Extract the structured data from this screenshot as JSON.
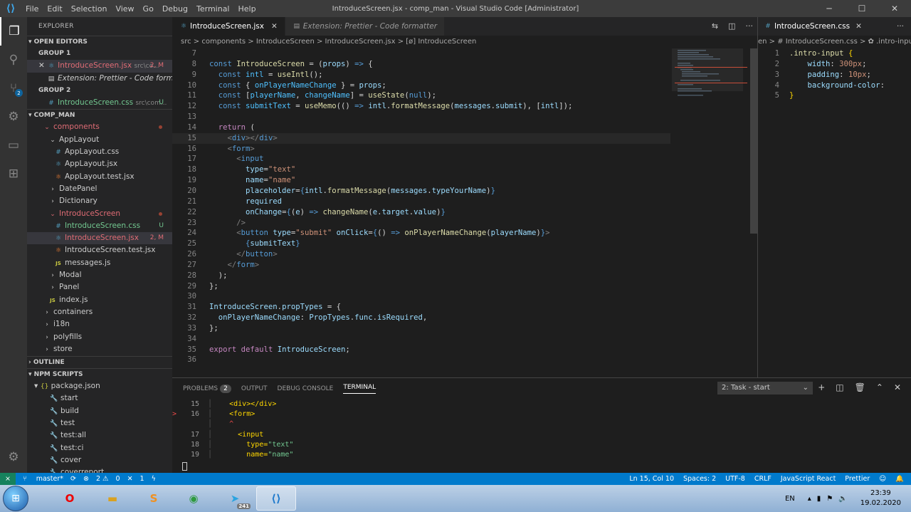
{
  "titlebar": {
    "title": "IntroduceScreen.jsx - comp_man - Visual Studio Code [Administrator]",
    "menu": [
      "File",
      "Edit",
      "Selection",
      "View",
      "Go",
      "Debug",
      "Terminal",
      "Help"
    ]
  },
  "activity": {
    "scm_badge": "2"
  },
  "explorer": {
    "title": "EXPLORER",
    "open_editors": "OPEN EDITORS",
    "group1": "GROUP 1",
    "group2": "GROUP 2",
    "g1_item1": {
      "name": "IntroduceScreen.jsx",
      "path": "src\\co...",
      "badge": "2, M"
    },
    "g1_item2": {
      "name": "Extension: Prettier - Code formatter"
    },
    "g2_item1": {
      "name": "IntroduceScreen.css",
      "path": "src\\com...",
      "badge": "U"
    },
    "project": "COMP_MAN",
    "tree": [
      {
        "label": "components",
        "indent": 22,
        "icon": "chevron-down",
        "cls": "c-red",
        "dot": true
      },
      {
        "label": "AppLayout",
        "indent": 30,
        "icon": "chevron-down"
      },
      {
        "label": "AppLayout.css",
        "indent": 38,
        "icon": "css"
      },
      {
        "label": "AppLayout.jsx",
        "indent": 38,
        "icon": "jsx"
      },
      {
        "label": "AppLayout.test.jsx",
        "indent": 38,
        "icon": "test"
      },
      {
        "label": "DatePanel",
        "indent": 30,
        "icon": "chevron-right"
      },
      {
        "label": "Dictionary",
        "indent": 30,
        "icon": "chevron-right"
      },
      {
        "label": "IntroduceScreen",
        "indent": 30,
        "icon": "chevron-down",
        "cls": "c-red",
        "dot": true
      },
      {
        "label": "IntroduceScreen.css",
        "indent": 38,
        "icon": "css",
        "cls": "c-green",
        "badge": "U"
      },
      {
        "label": "IntroduceScreen.jsx",
        "indent": 38,
        "icon": "jsx",
        "cls": "c-red",
        "badge": "2, M",
        "sel": true
      },
      {
        "label": "IntroduceScreen.test.jsx",
        "indent": 38,
        "icon": "test"
      },
      {
        "label": "messages.js",
        "indent": 38,
        "icon": "js"
      },
      {
        "label": "Modal",
        "indent": 30,
        "icon": "chevron-right"
      },
      {
        "label": "Panel",
        "indent": 30,
        "icon": "chevron-right"
      },
      {
        "label": "index.js",
        "indent": 30,
        "icon": "js"
      },
      {
        "label": "containers",
        "indent": 22,
        "icon": "chevron-right"
      },
      {
        "label": "i18n",
        "indent": 22,
        "icon": "chevron-right"
      },
      {
        "label": "polyfills",
        "indent": 22,
        "icon": "chevron-right"
      },
      {
        "label": "store",
        "indent": 22,
        "icon": "chevron-right"
      }
    ],
    "outline": "OUTLINE",
    "npm": "NPM SCRIPTS",
    "package": "package.json",
    "scripts": [
      "start",
      "build",
      "test",
      "test:all",
      "test:ci",
      "cover",
      "coverreport"
    ]
  },
  "tabs": [
    {
      "label": "IntroduceScreen.jsx",
      "active": true
    },
    {
      "label": "Extension: Prettier - Code formatter",
      "active": false
    }
  ],
  "breadcrumb": "src > components > IntroduceScreen > IntroduceScreen.jsx > [ø] IntroduceScreen",
  "code": [
    {
      "n": "7",
      "h": ""
    },
    {
      "n": "8",
      "h": "<span class=kw>const</span> <span class=fn>IntroduceScreen</span> <span class=pl>= (</span><span class=var>props</span><span class=pl>) </span><span class=kw>=&gt;</span> <span class=pl>{</span>"
    },
    {
      "n": "9",
      "h": "  <span class=kw>const</span> <span class=cst>intl</span> <span class=pl>=</span> <span class=fn>useIntl</span><span class=pl>();</span>"
    },
    {
      "n": "10",
      "h": "  <span class=kw>const</span> <span class=pl>{ </span><span class=cst>onPlayerNameChange</span><span class=pl> } = </span><span class=var>props</span><span class=pl>;</span>"
    },
    {
      "n": "11",
      "h": "  <span class=kw>const</span> <span class=pl>[</span><span class=cst>playerName</span><span class=pl>, </span><span class=cst>changeName</span><span class=pl>] = </span><span class=fn>useState</span><span class=pl>(</span><span class=kw>null</span><span class=pl>);</span>"
    },
    {
      "n": "12",
      "h": "  <span class=kw>const</span> <span class=cst>submitText</span> <span class=pl>=</span> <span class=fn>useMemo</span><span class=pl>(() </span><span class=kw>=&gt;</span> <span class=var>intl</span><span class=pl>.</span><span class=fn>formatMessage</span><span class=pl>(</span><span class=var>messages</span><span class=pl>.</span><span class=var>submit</span><span class=pl>), [</span><span class=var>intl</span><span class=pl>]);</span>"
    },
    {
      "n": "13",
      "h": ""
    },
    {
      "n": "14",
      "h": "  <span class=kw2>return</span> <span class=pl>(</span>"
    },
    {
      "n": "15",
      "h": "    <span class=tagb>&lt;</span><span class=tag>div</span><span class=tagb>&gt;&lt;/</span><span class=tag>div</span><span class=tagb>&gt;</span>",
      "cur": true
    },
    {
      "n": "16",
      "h": "    <span class=tagb>&lt;</span><span class=tag>form</span><span class=tagb>&gt;</span>"
    },
    {
      "n": "17",
      "h": "      <span class=tagb>&lt;</span><span class=tag>input</span>"
    },
    {
      "n": "18",
      "h": "        <span class=attr>type</span><span class=pl>=</span><span class=str>\"text\"</span>"
    },
    {
      "n": "19",
      "h": "        <span class=attr>name</span><span class=pl>=</span><span class=str>\"name\"</span>"
    },
    {
      "n": "20",
      "h": "        <span class=attr>placeholder</span><span class=pl>=</span><span class=kw>{</span><span class=var>intl</span><span class=pl>.</span><span class=fn>formatMessage</span><span class=pl>(</span><span class=var>messages</span><span class=pl>.</span><span class=var>typeYourName</span><span class=pl>)</span><span class=kw>}</span>"
    },
    {
      "n": "21",
      "h": "        <span class=attr>required</span>"
    },
    {
      "n": "22",
      "h": "        <span class=attr>onChange</span><span class=pl>=</span><span class=kw>{</span><span class=pl>(</span><span class=var>e</span><span class=pl>) </span><span class=kw>=&gt;</span> <span class=fn>changeName</span><span class=pl>(</span><span class=var>e</span><span class=pl>.</span><span class=var>target</span><span class=pl>.</span><span class=var>value</span><span class=pl>)</span><span class=kw>}</span>"
    },
    {
      "n": "23",
      "h": "      <span class=tagb>/&gt;</span>"
    },
    {
      "n": "24",
      "h": "      <span class=tagb>&lt;</span><span class=tag>button</span> <span class=attr>type</span><span class=pl>=</span><span class=str>\"submit\"</span> <span class=attr>onClick</span><span class=pl>=</span><span class=kw>{</span><span class=pl>() </span><span class=kw>=&gt;</span> <span class=fn>onPlayerNameChange</span><span class=pl>(</span><span class=var>playerName</span><span class=pl>)</span><span class=kw>}</span><span class=tagb>&gt;</span>"
    },
    {
      "n": "25",
      "h": "        <span class=kw>{</span><span class=var>submitText</span><span class=kw>}</span>"
    },
    {
      "n": "26",
      "h": "      <span class=tagb>&lt;/</span><span class=tag>button</span><span class=tagb>&gt;</span>"
    },
    {
      "n": "27",
      "h": "    <span class=tagb>&lt;/</span><span class=tag>form</span><span class=tagb>&gt;</span>"
    },
    {
      "n": "28",
      "h": "  <span class=pl>);</span>"
    },
    {
      "n": "29",
      "h": "<span class=pl>};</span>"
    },
    {
      "n": "30",
      "h": ""
    },
    {
      "n": "31",
      "h": "<span class=var>IntroduceScreen</span><span class=pl>.</span><span class=var>propTypes</span> <span class=pl>= {</span>"
    },
    {
      "n": "32",
      "h": "  <span class=var>onPlayerNameChange</span><span class=pl>: </span><span class=var>PropTypes</span><span class=pl>.</span><span class=var>func</span><span class=pl>.</span><span class=var>isRequired</span><span class=pl>,</span>"
    },
    {
      "n": "33",
      "h": "<span class=pl>};</span>"
    },
    {
      "n": "34",
      "h": ""
    },
    {
      "n": "35",
      "h": "<span class=kw2>export</span> <span class=kw2>default</span> <span class=var>IntroduceScreen</span><span class=pl>;</span>"
    },
    {
      "n": "36",
      "h": ""
    }
  ],
  "right": {
    "tab": "IntroduceScreen.css",
    "breadcrumb": "en > # IntroduceScreen.css > ✿ .intro-input",
    "code": [
      {
        "n": "1",
        "h": "<span class=fn>.intro-input</span> <span class=yel>{</span>"
      },
      {
        "n": "2",
        "h": "    <span class=var>width</span><span class=pl>: </span><span class=str>300px</span><span class=pl>;</span>"
      },
      {
        "n": "3",
        "h": "    <span class=var>padding</span><span class=pl>: </span><span class=str>10px</span><span class=pl>;</span>"
      },
      {
        "n": "4",
        "h": "    <span class=var>background-color</span><span class=pl>:</span>"
      },
      {
        "n": "5",
        "h": "<span class=yel>}</span>"
      }
    ]
  },
  "panel": {
    "tabs": [
      "PROBLEMS",
      "OUTPUT",
      "DEBUG CONSOLE",
      "TERMINAL"
    ],
    "problems_count": "2",
    "task": "2: Task - start",
    "term": [
      {
        "n": "15",
        "h": "    <span class=yel>&lt;div&gt;&lt;/div&gt;</span>"
      },
      {
        "n": "16",
        "m": "&gt;",
        "h": "    <span class=yel>&lt;form&gt;</span>"
      },
      {
        "n": "",
        "h": "    <span style='color:#f14c4c'>^</span>"
      },
      {
        "n": "17",
        "h": "      <span class=yel>&lt;input</span>"
      },
      {
        "n": "18",
        "h": "        <span class=yel>type=</span><span class=c-green>\"text\"</span>"
      },
      {
        "n": "19",
        "h": "        <span class=yel>name=</span><span class=c-green>\"name\"</span>"
      }
    ]
  },
  "status": {
    "branch": "master*",
    "errors": "2",
    "warnings": "0",
    "info": "1",
    "position": "Ln 15, Col 10",
    "spaces": "Spaces: 2",
    "encoding": "UTF-8",
    "eol": "CRLF",
    "lang": "JavaScript React",
    "formatter": "Prettier"
  },
  "taskbar": {
    "lang": "EN",
    "time": "23:39",
    "date": "19.02.2020",
    "telegram_badge": "241"
  }
}
